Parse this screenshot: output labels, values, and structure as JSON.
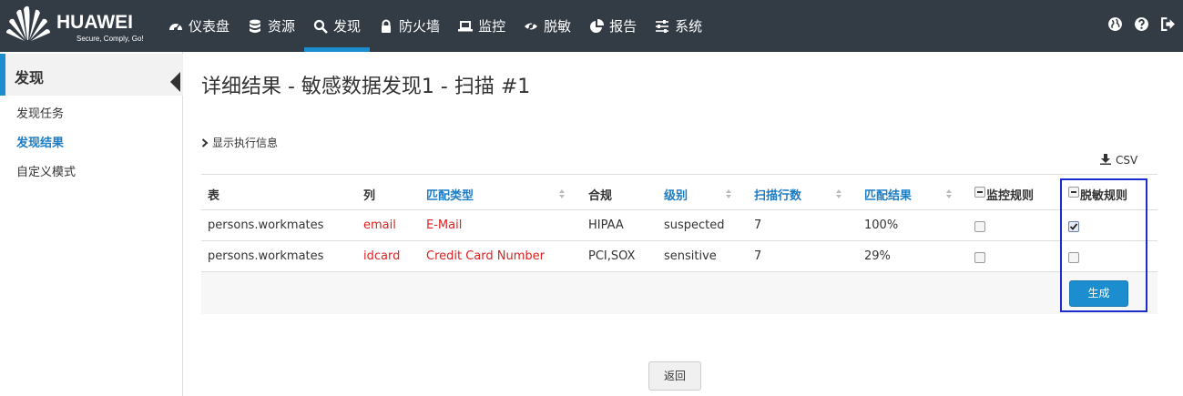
{
  "brand": {
    "name": "HUAWEI",
    "tagline": "Secure, Comply, Go!"
  },
  "nav": [
    {
      "label": "仪表盘",
      "icon": "dashboard-icon"
    },
    {
      "label": "资源",
      "icon": "database-icon"
    },
    {
      "label": "发现",
      "icon": "search-icon",
      "active": true
    },
    {
      "label": "防火墙",
      "icon": "lock-icon"
    },
    {
      "label": "监控",
      "icon": "laptop-icon"
    },
    {
      "label": "脱敏",
      "icon": "eye-slash-icon"
    },
    {
      "label": "报告",
      "icon": "pie-chart-icon"
    },
    {
      "label": "系统",
      "icon": "sliders-icon"
    }
  ],
  "top_icons": [
    "globe-icon",
    "help-icon",
    "logout-icon"
  ],
  "sidebar": {
    "title": "发现",
    "items": [
      {
        "label": "发现任务",
        "active": false
      },
      {
        "label": "发现结果",
        "active": true
      },
      {
        "label": "自定义模式",
        "active": false
      }
    ]
  },
  "page": {
    "title": "详细结果 - 敏感数据发现1 - 扫描 #1",
    "exec_toggle": "显示执行信息",
    "csv_label": "CSV"
  },
  "table": {
    "headers": {
      "table": "表",
      "column": "列",
      "match_type": "匹配类型",
      "compliance": "合规",
      "level": "级别",
      "scan_rows": "扫描行数",
      "match_result": "匹配结果",
      "monitor_rule": "监控规则",
      "mask_rule": "脱敏规则"
    },
    "rows": [
      {
        "table": "persons.workmates",
        "column": "email",
        "match_type": "E-Mail",
        "compliance": "HIPAA",
        "level": "suspected",
        "scan_rows": "7",
        "match_result": "100%",
        "monitor_checked": false,
        "mask_checked": true
      },
      {
        "table": "persons.workmates",
        "column": "idcard",
        "match_type": "Credit Card Number",
        "compliance": "PCI,SOX",
        "level": "sensitive",
        "scan_rows": "7",
        "match_result": "29%",
        "monitor_checked": false,
        "mask_checked": false
      }
    ]
  },
  "buttons": {
    "generate": "生成",
    "back": "返回"
  },
  "colors": {
    "topbar": "#333b45",
    "accent": "#1c8ed0",
    "link": "#1c7cc4",
    "red": "#e02020",
    "highlight": "#1a2ccc"
  }
}
